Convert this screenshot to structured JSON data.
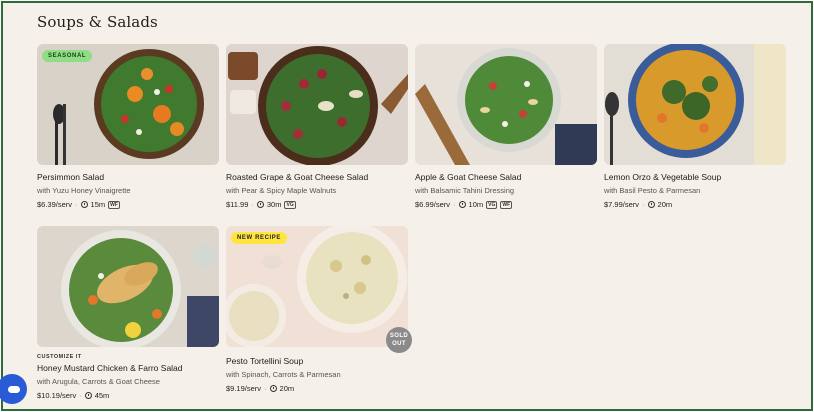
{
  "section_title": "Soups & Salads",
  "cards": [
    {
      "name": "Persimmon Salad",
      "sub": "with Yuzu Honey Vinaigrette",
      "price": "$6.39/serv",
      "time": "15m",
      "tags": [
        "WF"
      ],
      "badge": "SEASONAL"
    },
    {
      "name": "Roasted Grape & Goat Cheese Salad",
      "sub": "with Pear & Spicy Maple Walnuts",
      "price": "$11.99",
      "time": "30m",
      "tags": [
        "VG"
      ]
    },
    {
      "name": "Apple & Goat Cheese Salad",
      "sub": "with Balsamic Tahini Dressing",
      "price": "$6.99/serv",
      "time": "10m",
      "tags": [
        "VG",
        "WF"
      ]
    },
    {
      "name": "Lemon Orzo & Vegetable Soup",
      "sub": "with Basil Pesto & Parmesan",
      "price": "$7.99/serv",
      "time": "20m",
      "tags": []
    },
    {
      "kicker": "CUSTOMIZE IT",
      "name": "Honey Mustard Chicken & Farro Salad",
      "sub": "with Arugula, Carrots & Goat Cheese",
      "price": "$10.19/serv",
      "time": "45m",
      "tags": []
    },
    {
      "name": "Pesto Tortellini Soup",
      "sub": "with Spinach, Carrots & Parmesan",
      "price": "$9.19/serv",
      "time": "20m",
      "tags": [],
      "badge": "NEW RECIPE",
      "sold_out": "SOLD OUT"
    }
  ],
  "sold_out_lines": [
    "SOLD",
    "OUT"
  ],
  "colors": {
    "background": "#f5f1ea",
    "seasonal_badge": "#8fdd84",
    "new_badge": "#ffe53d",
    "chat_button": "#2a5bd7"
  },
  "icons": [
    "clock-icon",
    "chat-icon"
  ]
}
